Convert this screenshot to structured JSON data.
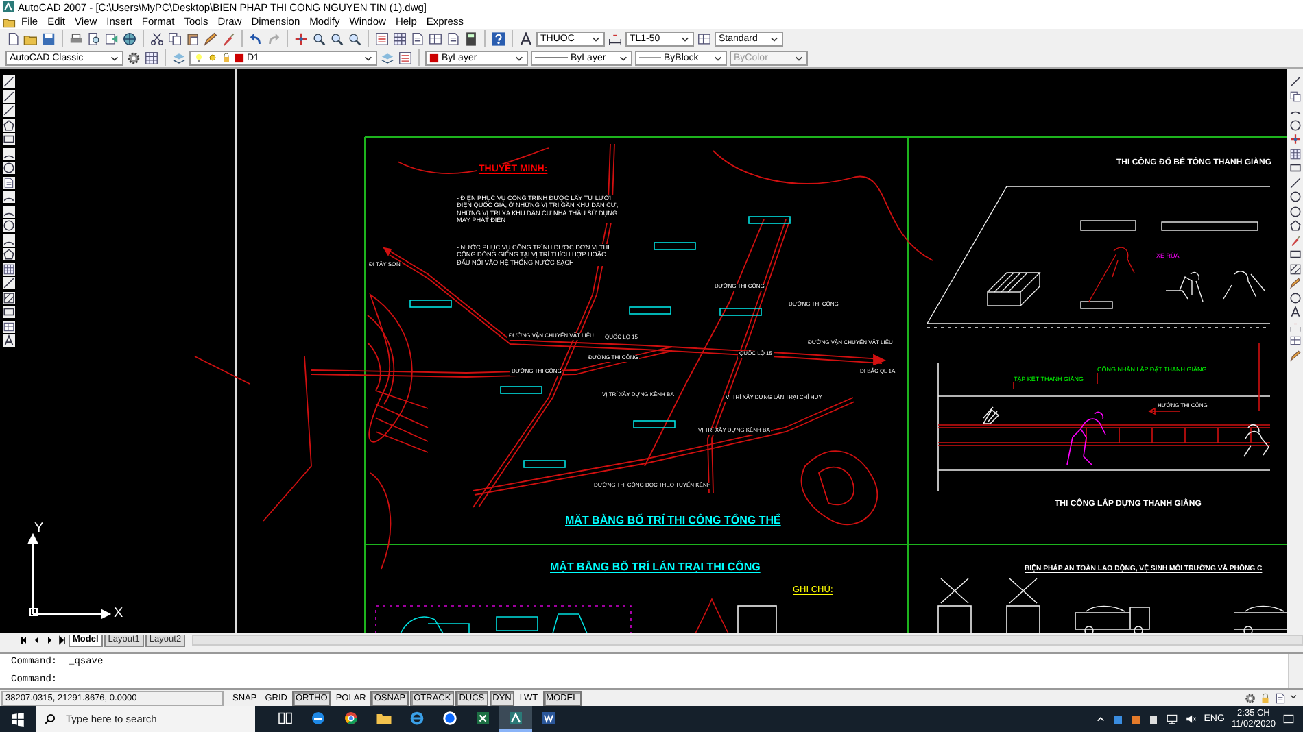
{
  "window": {
    "title": "AutoCAD 2007 - [C:\\Users\\MyPC\\Desktop\\BIEN PHAP THI CONG NGUYEN TIN (1).dwg]"
  },
  "menu": [
    "File",
    "Edit",
    "View",
    "Insert",
    "Format",
    "Tools",
    "Draw",
    "Dimension",
    "Modify",
    "Window",
    "Help",
    "Express"
  ],
  "toolbar": {
    "text_style": "THUOC",
    "dim_style": "TL1-50",
    "table_style": "Standard",
    "workspace": "AutoCAD Classic",
    "layer": "D1",
    "color_setting": "ByLayer",
    "linetype": "ByLayer",
    "lineweight": "ByBlock",
    "plot_style": "ByColor"
  },
  "drawing": {
    "labels": [
      {
        "text": "THUYẾT MINH:",
        "kind": "note_heading"
      },
      {
        "text": "- ĐIỆN PHỤC VỤ CÔNG TRÌNH ĐƯỢC LẤY TỪ LƯỚI ĐIỆN QUỐC GIA, Ở NHỮNG VỊ TRÍ GẦN KHU DÂN CƯ, NHỮNG VỊ TRÍ XA KHU DÂN CƯ NHÀ THẦU SỬ DỤNG MÁY PHÁT ĐIỆN",
        "kind": "note"
      },
      {
        "text": "ĐI TÂY SƠN",
        "kind": "map_label"
      },
      {
        "text": "- NƯỚC PHỤC VỤ CÔNG TRÌNH ĐƯỢC ĐƠN VỊ THI CÔNG ĐÓNG GIẾNG TẠI VỊ TRÍ THÍCH HỢP HOẶC ĐẤU NỐI VÀO HỆ THỐNG NƯỚC SẠCH",
        "kind": "note"
      },
      {
        "text": "ĐƯỜNG VẬN CHUYỂN VẬT LIỆU",
        "kind": "map_label"
      },
      {
        "text": "QUỐC LỘ 15",
        "kind": "map_label"
      },
      {
        "text": "ĐƯỜNG THI CÔNG",
        "kind": "map_label"
      },
      {
        "text": "ĐƯỜNG THI CÔNG",
        "kind": "map_label"
      },
      {
        "text": "ĐƯỜNG THI CÔNG",
        "kind": "map_label"
      },
      {
        "text": "ĐƯỜNG THI CÔNG",
        "kind": "map_label"
      },
      {
        "text": "QUỐC LỘ 15",
        "kind": "map_label"
      },
      {
        "text": "ĐƯỜNG VẬN CHUYỂN VẬT LIỆU",
        "kind": "map_label"
      },
      {
        "text": "ĐI BẮC QL 1A",
        "kind": "map_label"
      },
      {
        "text": "VỊ TRÍ XÂY DỰNG KÊNH BA",
        "kind": "map_label"
      },
      {
        "text": "VỊ TRÍ XÂY DỰNG LÁN TRẠI CHỈ HUY",
        "kind": "map_label"
      },
      {
        "text": "VỊ TRÍ XÂY DỰNG KÊNH BA",
        "kind": "map_label"
      },
      {
        "text": "ĐƯỜNG THI CÔNG DỌC THEO TUYẾN KÊNH",
        "kind": "map_label"
      },
      {
        "text": "MẶT BẰNG BỐ TRÍ THI CÔNG TỔNG THỂ",
        "kind": "section_title"
      },
      {
        "text": "THI CÔNG ĐỔ BÊ TÔNG THANH GIẰNG",
        "kind": "detail_title"
      },
      {
        "text": "XE RÙA",
        "kind": "equipment_label"
      },
      {
        "text": "TẬP KẾT THANH GIẰNG",
        "kind": "callout"
      },
      {
        "text": "CÔNG NHÂN LẮP ĐẶT THANH GIẰNG",
        "kind": "callout"
      },
      {
        "text": "HƯỚNG THI CÔNG",
        "kind": "direction_label"
      },
      {
        "text": "THI CÔNG LẮP DỰNG THANH GIẰNG",
        "kind": "detail_title"
      },
      {
        "text": "MẶT BẰNG BỐ TRÍ LÁN TRẠI THI CÔNG",
        "kind": "section_title"
      },
      {
        "text": "GHI CHÚ:",
        "kind": "legend_heading"
      },
      {
        "text": "BIỆN PHÁP AN TOÀN LAO ĐỘNG, VỆ SINH MÔI TRƯỜNG VÀ PHÒNG C",
        "kind": "detail_title"
      }
    ],
    "ucs": {
      "x_label": "X",
      "y_label": "Y"
    }
  },
  "layout_tabs": [
    {
      "label": "Model",
      "selected": true
    },
    {
      "label": "Layout1",
      "selected": false
    },
    {
      "label": "Layout2",
      "selected": false
    }
  ],
  "command_lines": [
    "Command:  _qsave",
    "Command:"
  ],
  "status_bar": {
    "coordinates": "38207.0315, 21291.8676, 0.0000",
    "toggles": [
      {
        "label": "SNAP",
        "on": false
      },
      {
        "label": "GRID",
        "on": false
      },
      {
        "label": "ORTHO",
        "on": true
      },
      {
        "label": "POLAR",
        "on": false
      },
      {
        "label": "OSNAP",
        "on": true
      },
      {
        "label": "OTRACK",
        "on": true
      },
      {
        "label": "DUCS",
        "on": true
      },
      {
        "label": "DYN",
        "on": true
      },
      {
        "label": "LWT",
        "on": false
      }
    ],
    "space": "MODEL"
  },
  "taskbar": {
    "search_placeholder": "Type here to search",
    "apps": [
      {
        "kind": "taskview",
        "selected": false
      },
      {
        "kind": "edge",
        "selected": false
      },
      {
        "kind": "chrome",
        "selected": false
      },
      {
        "kind": "explorer",
        "selected": false
      },
      {
        "kind": "ie",
        "selected": false
      },
      {
        "kind": "chat",
        "selected": false
      },
      {
        "kind": "excel",
        "selected": false
      },
      {
        "kind": "autocad",
        "selected": true
      },
      {
        "kind": "word",
        "selected": false
      }
    ],
    "language": "ENG",
    "time": "2:35 CH",
    "date": "11/02/2020"
  }
}
